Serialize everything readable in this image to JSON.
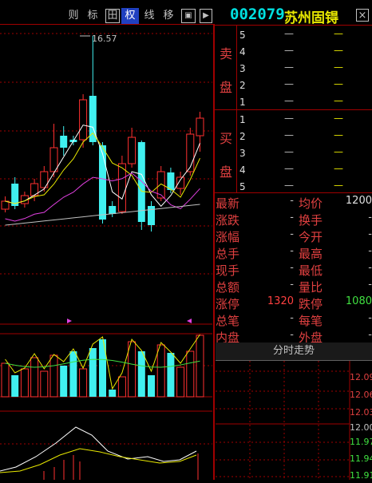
{
  "toolbar": {
    "buttons": [
      "则",
      "标",
      "田",
      "权",
      "线",
      "移",
      "▣",
      "▶"
    ],
    "active_index": 3
  },
  "stock": {
    "code": "002079",
    "name": "苏州固锝"
  },
  "close_icon": "close-icon",
  "chart": {
    "high_label": "16.57",
    "candles": [
      {
        "o": 262,
        "c": 252,
        "h": 246,
        "l": 266,
        "up": true
      },
      {
        "o": 230,
        "c": 258,
        "h": 222,
        "l": 262,
        "up": false
      },
      {
        "o": 255,
        "c": 245,
        "h": 240,
        "l": 260,
        "up": true
      },
      {
        "o": 245,
        "c": 230,
        "h": 224,
        "l": 252,
        "up": true
      },
      {
        "o": 215,
        "c": 235,
        "h": 208,
        "l": 240,
        "up": true
      },
      {
        "o": 215,
        "c": 185,
        "h": 155,
        "l": 222,
        "up": true
      },
      {
        "o": 185,
        "c": 170,
        "h": 158,
        "l": 195,
        "up": false
      },
      {
        "o": 178,
        "c": 175,
        "h": 170,
        "l": 182,
        "up": false
      },
      {
        "o": 175,
        "c": 125,
        "h": 118,
        "l": 185,
        "up": true
      },
      {
        "o": 120,
        "c": 178,
        "h": 45,
        "l": 182,
        "up": false
      },
      {
        "o": 182,
        "c": 275,
        "h": 178,
        "l": 280,
        "up": false
      },
      {
        "o": 258,
        "c": 268,
        "h": 252,
        "l": 272,
        "up": false
      },
      {
        "o": 265,
        "c": 205,
        "h": 195,
        "l": 268,
        "up": true
      },
      {
        "o": 205,
        "c": 172,
        "h": 160,
        "l": 210,
        "up": true
      },
      {
        "o": 178,
        "c": 278,
        "h": 176,
        "l": 288,
        "up": false
      },
      {
        "o": 258,
        "c": 282,
        "h": 252,
        "l": 290,
        "up": false
      },
      {
        "o": 248,
        "c": 215,
        "h": 208,
        "l": 252,
        "up": true
      },
      {
        "o": 216,
        "c": 238,
        "h": 210,
        "l": 242,
        "up": false
      },
      {
        "o": 236,
        "c": 222,
        "h": 215,
        "l": 244,
        "up": true
      },
      {
        "o": 215,
        "c": 168,
        "h": 160,
        "l": 220,
        "up": true
      },
      {
        "o": 170,
        "c": 148,
        "h": 140,
        "l": 190,
        "up": true
      }
    ]
  },
  "order_book": {
    "sell_label_1": "卖",
    "sell_label_2": "盘",
    "buy_label_1": "买",
    "buy_label_2": "盘",
    "sell_levels": [
      "5",
      "4",
      "3",
      "2",
      "1"
    ],
    "buy_levels": [
      "1",
      "2",
      "3",
      "4",
      "5"
    ],
    "dash": "—",
    "dash_yellow": "--"
  },
  "quote": {
    "rows": [
      {
        "l": "最新",
        "lv": "-",
        "r": "均价",
        "rv": "1200"
      },
      {
        "l": "涨跌",
        "lv": "-",
        "r": "换手",
        "rv": "-"
      },
      {
        "l": "涨幅",
        "lv": "-",
        "r": "今开",
        "rv": "-"
      },
      {
        "l": "总手",
        "lv": "-",
        "r": "最高",
        "rv": "-"
      },
      {
        "l": "现手",
        "lv": "-",
        "r": "最低",
        "rv": "-"
      },
      {
        "l": "总额",
        "lv": "-",
        "r": "量比",
        "rv": "-"
      },
      {
        "l": "涨停",
        "lv": "1320",
        "r": "跌停",
        "rv": "1080"
      },
      {
        "l": "总笔",
        "lv": "-",
        "r": "每笔",
        "rv": "-"
      },
      {
        "l": "内盘",
        "lv": "-",
        "r": "外盘",
        "rv": "-"
      }
    ]
  },
  "intraday": {
    "title": "分时走势",
    "prices": [
      "12.09",
      "12.06",
      "12.03",
      "12.00",
      "11.97",
      "11.94",
      "11.91"
    ]
  },
  "colors": {
    "up": "#ff3030",
    "down": "#40f0f0",
    "ma5": "#ffffff",
    "ma10": "#e8e800",
    "ma20": "#e040e0",
    "ma60": "#c0c0c0"
  }
}
